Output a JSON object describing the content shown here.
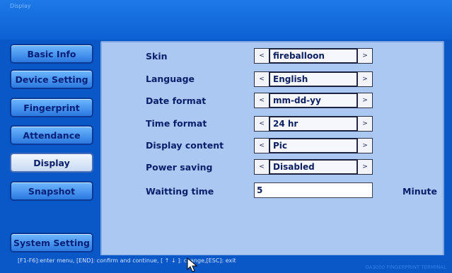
{
  "window": {
    "title": "Display"
  },
  "sidebar": {
    "items": [
      {
        "label": "Basic Info"
      },
      {
        "label": "Device Setting"
      },
      {
        "label": "Fingerprint"
      },
      {
        "label": "Attendance"
      },
      {
        "label": "Display",
        "active": true
      },
      {
        "label": "Snapshot"
      },
      {
        "label": "System Setting"
      }
    ]
  },
  "settings": {
    "skin": {
      "label": "Skin",
      "value": "fireballoon"
    },
    "language": {
      "label": "Language",
      "value": "English"
    },
    "date_format": {
      "label": "Date format",
      "value": "mm-dd-yy"
    },
    "time_format": {
      "label": "Time format",
      "value": "24 hr"
    },
    "display_content": {
      "label": "Display content",
      "value": "Pic"
    },
    "power_saving": {
      "label": "Power saving",
      "value": "Disabled"
    },
    "waiting_time": {
      "label": "Waitting time",
      "value": "5",
      "unit": "Minute"
    }
  },
  "arrows": {
    "prev": "<",
    "next": ">"
  },
  "status": {
    "hint": "[F1-F6]:enter menu, [END]: confirm and continue, [ ↑ ↓ ]: change,[ESC]: exit",
    "brand": "OA3000 FINGERPRINT TERMINAL"
  },
  "colors": {
    "background": "#0a58c8",
    "panel": "#aac8f2",
    "nav_button": "#4d9af2",
    "nav_active": "#dde8f8",
    "text_dark": "#0a1f6a"
  }
}
